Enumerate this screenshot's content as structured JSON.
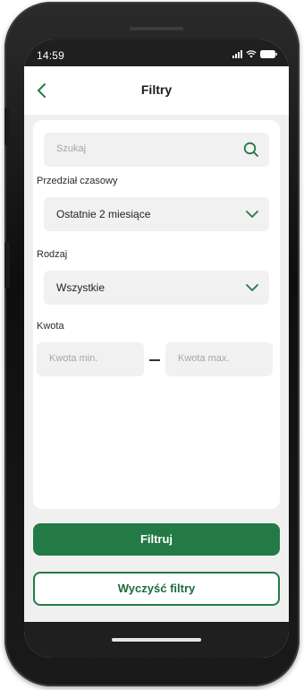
{
  "status_bar": {
    "time": "14:59"
  },
  "nav": {
    "title": "Filtry",
    "back_icon": "chevron-left-icon"
  },
  "filters": {
    "search": {
      "placeholder": "Szukaj",
      "icon": "search-icon"
    },
    "period": {
      "label": "Przedział czasowy",
      "value": "Ostatnie 2 miesiące"
    },
    "type": {
      "label": "Rodzaj",
      "value": "Wszystkie"
    },
    "amount": {
      "label": "Kwota",
      "min_placeholder": "Kwota min.",
      "max_placeholder": "Kwota max."
    }
  },
  "actions": {
    "filter_label": "Filtruj",
    "clear_label": "Wyczyść filtry"
  },
  "colors": {
    "accent": "#237a45",
    "screen_background": "#f0f0f0",
    "field_background": "#f1f1f1"
  }
}
